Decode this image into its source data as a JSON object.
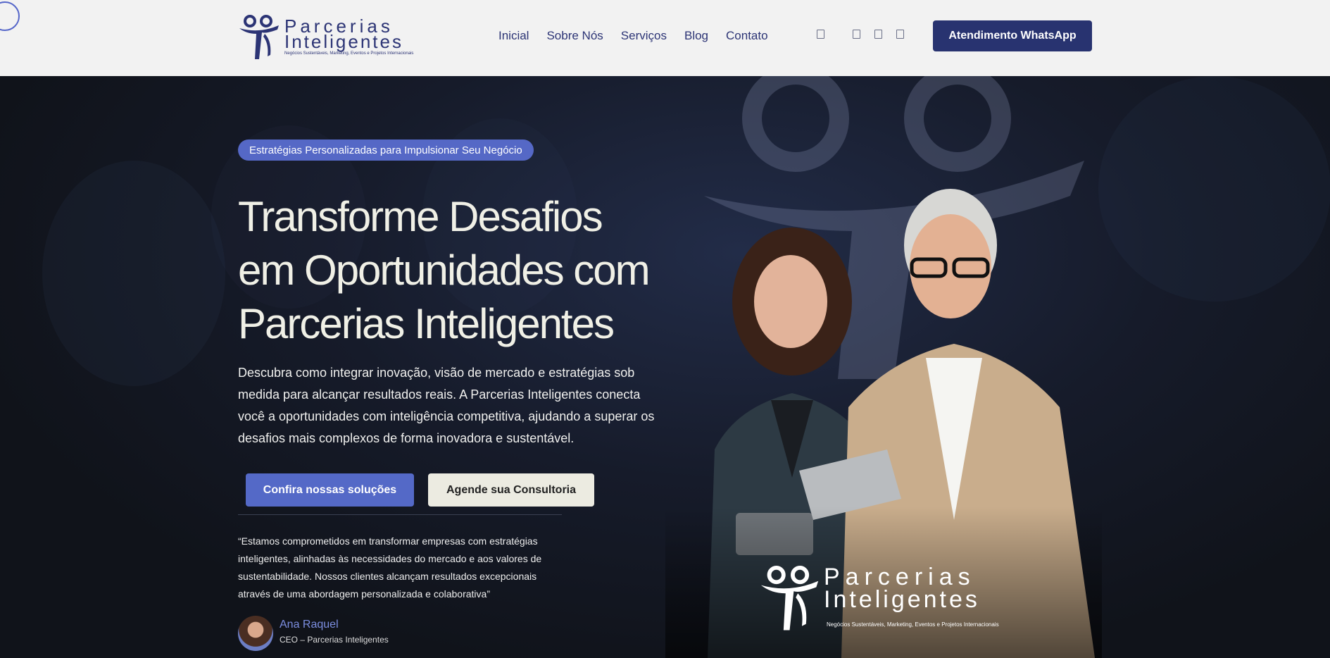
{
  "header": {
    "logo": {
      "word1": "Parcerias",
      "word2": "Inteligentes",
      "tagline": "Negócios Sustentáveis, Marketing, Eventos e Projetos Internacionais"
    },
    "nav": [
      "Inicial",
      "Sobre Nós",
      "Serviços",
      "Blog",
      "Contato"
    ],
    "social_icons": [
      "facebook-icon",
      "instagram-icon",
      "linkedin-icon",
      "youtube-icon"
    ],
    "cta_label": "Atendimento WhatsApp"
  },
  "hero": {
    "badge": "Estratégias Personalizadas para Impulsionar Seu Negócio",
    "headline": [
      "Transforme Desafios",
      "em Oportunidades com",
      "Parcerias Inteligentes"
    ],
    "subtext": "Descubra como integrar inovação, visão de mercado e estratégias sob medida para alcançar resultados reais. A Parcerias Inteligentes conecta você a oportunidades com inteligência competitiva, ajudando a superar os desafios mais complexos de forma inovadora e sustentável.",
    "primary_button": "Confira nossas soluções",
    "secondary_button": "Agende sua Consultoria",
    "quote": "“Estamos comprometidos em transformar empresas com estratégias inteligentes, alinhadas às necessidades do mercado e aos valores de sustentabilidade. Nossos clientes alcançam resultados excepcionais através de uma abordagem personalizada e colaborativa”",
    "author_name": "Ana Raquel",
    "author_role": "CEO – Parcerias Inteligentes",
    "photo_logo": {
      "word1": "Parcerias",
      "word2": "Inteligentes",
      "tagline": "Negócios Sustentáveis, Marketing, Eventos e Projetos Internacionais"
    }
  },
  "colors": {
    "brand": "#283370",
    "accent": "#5469c7",
    "background": "#12151d"
  }
}
